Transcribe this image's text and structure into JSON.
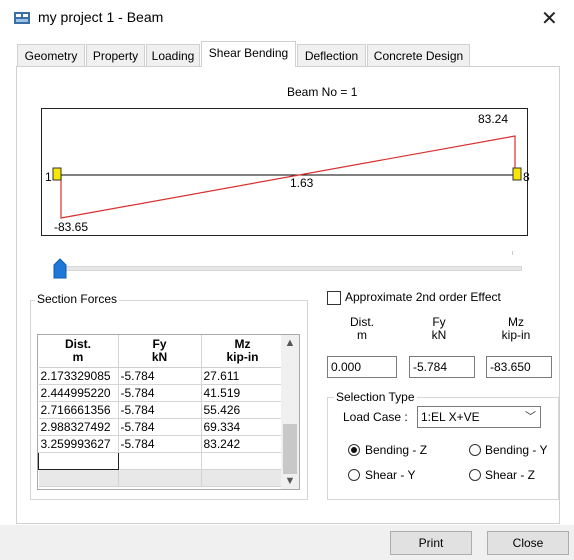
{
  "window": {
    "title": "my project 1 - Beam",
    "close_glyph": "✕"
  },
  "tabs": [
    {
      "label": "Geometry",
      "active": false
    },
    {
      "label": "Property",
      "active": false
    },
    {
      "label": "Loading",
      "active": false
    },
    {
      "label": "Shear Bending",
      "active": true
    },
    {
      "label": "Deflection",
      "active": false
    },
    {
      "label": "Concrete Design",
      "active": false
    }
  ],
  "diagram": {
    "beam_label": "Beam No = 1",
    "max_value": "83.24",
    "min_value": "-83.65",
    "mid_value": "1.63",
    "start_node": "1",
    "end_node": "8",
    "line_color": "#d83030"
  },
  "slider": {
    "position": 0.0
  },
  "section_forces": {
    "title": "Section Forces",
    "headers": [
      {
        "line1": "Dist.",
        "line2": "m"
      },
      {
        "line1": "Fy",
        "line2": "kN"
      },
      {
        "line1": "Mz",
        "line2": "kip-in"
      }
    ],
    "rows": [
      [
        "2.173329085",
        "-5.784",
        "27.611"
      ],
      [
        "2.444995220",
        "-5.784",
        "41.519"
      ],
      [
        "2.716661356",
        "-5.784",
        "55.426"
      ],
      [
        "2.988327492",
        "-5.784",
        "69.334"
      ],
      [
        "3.259993627",
        "-5.784",
        "83.242"
      ]
    ]
  },
  "approx_2nd_order": {
    "label": "Approximate 2nd order Effect",
    "checked": false
  },
  "current": {
    "headers": [
      {
        "line1": "Dist.",
        "line2": "m"
      },
      {
        "line1": "Fy",
        "line2": "kN"
      },
      {
        "line1": "Mz",
        "line2": "kip-in"
      }
    ],
    "dist": "0.000",
    "fy": "-5.784",
    "mz": "-83.650"
  },
  "selection_type": {
    "title": "Selection Type",
    "load_case_label": "Load Case :",
    "load_case_value": "1:EL X+VE",
    "options": [
      {
        "label": "Bending - Z",
        "checked": true
      },
      {
        "label": "Bending - Y",
        "checked": false
      },
      {
        "label": "Shear - Y",
        "checked": false
      },
      {
        "label": "Shear - Z",
        "checked": false
      }
    ]
  },
  "buttons": {
    "print": "Print",
    "close": "Close"
  }
}
